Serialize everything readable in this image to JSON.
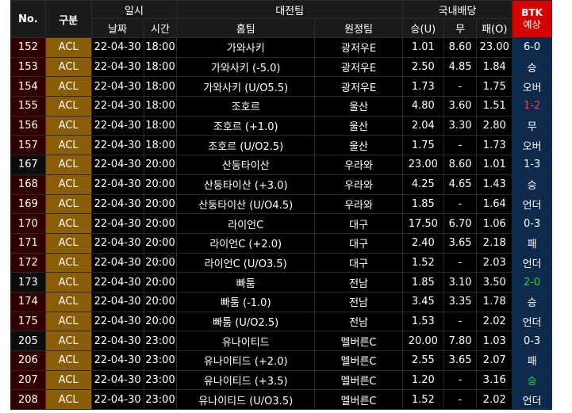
{
  "header": {
    "no": "No.",
    "gubun": "구분",
    "datetime": "일시",
    "date": "날짜",
    "time": "시간",
    "match": "대전팀",
    "home": "홈팀",
    "away": "원정팀",
    "odds": "국내배당",
    "win": "승(U)",
    "draw": "무",
    "lose": "패(O)",
    "btk_line1": "BTK",
    "btk_line2": "예상"
  },
  "colors": {
    "header_bg": "#1a1a1a",
    "gubun_bg": "#8a5e08",
    "no_bg": "#330000",
    "result_bg": "#0c2a4e",
    "btk_bg": "#d60000",
    "red_text": "#ff3b3b",
    "green_text": "#2fd23a"
  },
  "rows": [
    {
      "no": "152",
      "gubun": "ACL",
      "date": "22-04-30",
      "time": "18:00",
      "home": "가와사키",
      "away": "광저우E",
      "win": "1.01",
      "draw": "8.60",
      "lose": "23.00",
      "result": "6-0",
      "result_color": "white"
    },
    {
      "no": "153",
      "gubun": "ACL",
      "date": "22-04-30",
      "time": "18:00",
      "home": "가와사키 (-5.0)",
      "away": "광저우E",
      "win": "2.50",
      "draw": "4.85",
      "lose": "1.84",
      "result": "승",
      "result_color": "white"
    },
    {
      "no": "154",
      "gubun": "ACL",
      "date": "22-04-30",
      "time": "18:00",
      "home": "가와사키 (U/O5.5)",
      "away": "광저우E",
      "win": "1.73",
      "draw": "-",
      "lose": "1.75",
      "result": "오버",
      "result_color": "white"
    },
    {
      "no": "155",
      "gubun": "ACL",
      "date": "22-04-30",
      "time": "18:00",
      "home": "조호르",
      "away": "울산",
      "win": "4.80",
      "draw": "3.60",
      "lose": "1.51",
      "result": "1-2",
      "result_color": "red"
    },
    {
      "no": "156",
      "gubun": "ACL",
      "date": "22-04-30",
      "time": "18:00",
      "home": "조호르 (+1.0)",
      "away": "울산",
      "win": "2.04",
      "draw": "3.30",
      "lose": "2.80",
      "result": "무",
      "result_color": "white"
    },
    {
      "no": "157",
      "gubun": "ACL",
      "date": "22-04-30",
      "time": "18:00",
      "home": "조호르 (U/O2.5)",
      "away": "울산",
      "win": "1.75",
      "draw": "-",
      "lose": "1.73",
      "result": "오버",
      "result_color": "white"
    },
    {
      "no": "167",
      "gubun": "ACL",
      "date": "22-04-30",
      "time": "20:00",
      "home": "산둥타이산",
      "away": "우라와",
      "win": "23.00",
      "draw": "8.60",
      "lose": "1.01",
      "result": "1-3",
      "result_color": "white"
    },
    {
      "no": "168",
      "gubun": "ACL",
      "date": "22-04-30",
      "time": "20:00",
      "home": "산둥타이산 (+3.0)",
      "away": "우라와",
      "win": "4.25",
      "draw": "4.65",
      "lose": "1.43",
      "result": "승",
      "result_color": "white"
    },
    {
      "no": "169",
      "gubun": "ACL",
      "date": "22-04-30",
      "time": "20:00",
      "home": "산둥타이산 (U/O4.5)",
      "away": "우라와",
      "win": "1.85",
      "draw": "-",
      "lose": "1.64",
      "result": "언더",
      "result_color": "white"
    },
    {
      "no": "170",
      "gubun": "ACL",
      "date": "22-04-30",
      "time": "20:00",
      "home": "라이언C",
      "away": "대구",
      "win": "17.50",
      "draw": "6.70",
      "lose": "1.06",
      "result": "0-3",
      "result_color": "white"
    },
    {
      "no": "171",
      "gubun": "ACL",
      "date": "22-04-30",
      "time": "20:00",
      "home": "라이언C (+2.0)",
      "away": "대구",
      "win": "2.40",
      "draw": "3.65",
      "lose": "2.18",
      "result": "패",
      "result_color": "white"
    },
    {
      "no": "172",
      "gubun": "ACL",
      "date": "22-04-30",
      "time": "20:00",
      "home": "라이언C (U/O3.5)",
      "away": "대구",
      "win": "1.52",
      "draw": "-",
      "lose": "2.03",
      "result": "언더",
      "result_color": "white"
    },
    {
      "no": "173",
      "gubun": "ACL",
      "date": "22-04-30",
      "time": "20:00",
      "home": "빠툼",
      "away": "전남",
      "win": "1.85",
      "draw": "3.10",
      "lose": "3.50",
      "result": "2-0",
      "result_color": "green"
    },
    {
      "no": "174",
      "gubun": "ACL",
      "date": "22-04-30",
      "time": "20:00",
      "home": "빠툼 (-1.0)",
      "away": "전남",
      "win": "3.45",
      "draw": "3.35",
      "lose": "1.78",
      "result": "승",
      "result_color": "white"
    },
    {
      "no": "175",
      "gubun": "ACL",
      "date": "22-04-30",
      "time": "20:00",
      "home": "빠툼 (U/O2.5)",
      "away": "전남",
      "win": "1.53",
      "draw": "-",
      "lose": "2.02",
      "result": "언더",
      "result_color": "white"
    },
    {
      "no": "205",
      "gubun": "ACL",
      "date": "22-04-30",
      "time": "23:00",
      "home": "유나이티드",
      "away": "멜버른C",
      "win": "20.00",
      "draw": "7.80",
      "lose": "1.03",
      "result": "0-3",
      "result_color": "white"
    },
    {
      "no": "206",
      "gubun": "ACL",
      "date": "22-04-30",
      "time": "23:00",
      "home": "유나이티드 (+2.0)",
      "away": "멜버른C",
      "win": "2.55",
      "draw": "3.65",
      "lose": "2.07",
      "result": "패",
      "result_color": "white"
    },
    {
      "no": "207",
      "gubun": "ACL",
      "date": "22-04-30",
      "time": "23:00",
      "home": "유나이티드 (+3.5)",
      "away": "멜버른C",
      "win": "1.20",
      "draw": "-",
      "lose": "3.16",
      "result": "승",
      "result_color": "green"
    },
    {
      "no": "208",
      "gubun": "ACL",
      "date": "22-04-30",
      "time": "23:00",
      "home": "유나이티드 (U/O3.5)",
      "away": "멜버른C",
      "win": "1.52",
      "draw": "-",
      "lose": "2.02",
      "result": "언더",
      "result_color": "white"
    }
  ]
}
